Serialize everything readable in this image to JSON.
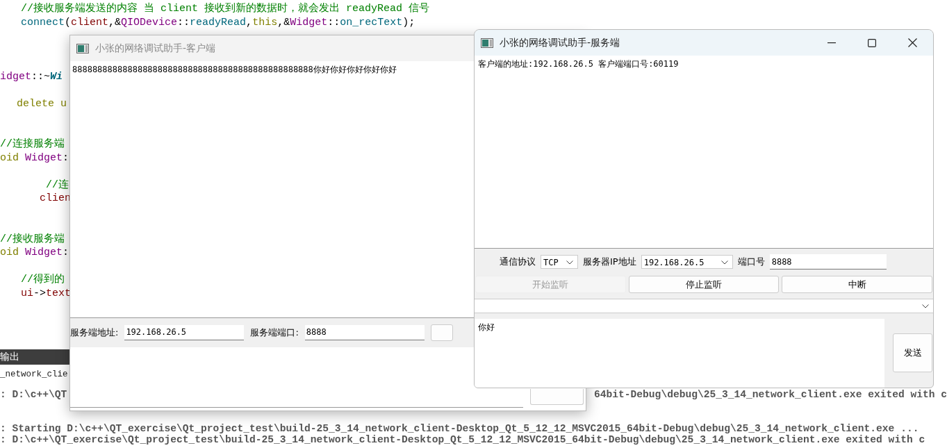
{
  "editor": {
    "lines": [
      {
        "segments": [
          {
            "kind": "comment",
            "text": "//接收服务端发送的内容 当 client 接收到新的数据时，就会发出 readyRead 信号"
          }
        ]
      },
      {
        "segments": [
          {
            "kind": "function",
            "text": "connect"
          },
          {
            "kind": "plain",
            "text": "("
          },
          {
            "kind": "member",
            "text": "client"
          },
          {
            "kind": "plain",
            "text": ",&"
          },
          {
            "kind": "type",
            "text": "QIODevice"
          },
          {
            "kind": "plain",
            "text": "::"
          },
          {
            "kind": "function",
            "text": "readyRead"
          },
          {
            "kind": "plain",
            "text": ","
          },
          {
            "kind": "keyword",
            "text": "this"
          },
          {
            "kind": "plain",
            "text": ",&"
          },
          {
            "kind": "type",
            "text": "Widget"
          },
          {
            "kind": "plain",
            "text": "::"
          },
          {
            "kind": "function",
            "text": "on_recText"
          },
          {
            "kind": "plain",
            "text": ");"
          }
        ]
      },
      {
        "segments": [
          {
            "kind": "type",
            "text": "idget"
          },
          {
            "kind": "plain",
            "text": "::~"
          },
          {
            "kind": "destructor",
            "text": "Wi"
          }
        ]
      },
      {
        "segments": [
          {
            "kind": "keyword",
            "text": "delete u"
          }
        ]
      },
      {
        "segments": [
          {
            "kind": "comment",
            "text": "//连接服务端"
          }
        ]
      },
      {
        "segments": [
          {
            "kind": "keyword",
            "text": "oid "
          },
          {
            "kind": "type",
            "text": "Widget"
          },
          {
            "kind": "plain",
            "text": ":"
          }
        ]
      },
      {
        "segments": [
          {
            "kind": "comment",
            "text": "//连"
          }
        ]
      },
      {
        "segments": [
          {
            "kind": "member",
            "text": "clien"
          }
        ]
      },
      {
        "segments": [
          {
            "kind": "comment",
            "text": "//接收服务端"
          }
        ]
      },
      {
        "segments": [
          {
            "kind": "keyword",
            "text": "oid "
          },
          {
            "kind": "type",
            "text": "Widget"
          },
          {
            "kind": "plain",
            "text": ":"
          }
        ]
      },
      {
        "segments": [
          {
            "kind": "comment",
            "text": "//得到的"
          }
        ]
      },
      {
        "segments": [
          {
            "kind": "member",
            "text": "ui"
          },
          {
            "kind": "plain",
            "text": "->"
          },
          {
            "kind": "member",
            "text": "text"
          }
        ]
      }
    ]
  },
  "output": {
    "title": "输出",
    "lines": [
      {
        "parts": [
          "_network_clie"
        ]
      },
      {
        "parts": [
          ": D:\\c++\\QT",
          "64bit-Debug\\debug\\25_3_14_network_client.exe exited with c"
        ]
      },
      {
        "parts": [
          ": Starting D:\\c++\\QT_exercise\\Qt_project_test\\build-25_3_14_network_client-Desktop_Qt_5_12_12_MSVC2015_64bit-Debug\\debug\\25_3_14_network_client.exe ..."
        ]
      },
      {
        "parts": [
          ": D:\\c++\\QT_exercise\\Qt_project_test\\build-25_3_14_network_client-Desktop_Qt_5_12_12_MSVC2015_64bit-Debug\\debug\\25_3_14_network_client.exe exited with c"
        ]
      }
    ]
  },
  "client_window": {
    "title": "小张的网络调试助手-客户端",
    "active": false,
    "received_text": "888888888888888888888888888888888888888888888888你好你好你好你好你好",
    "address_label": "服务端地址:",
    "address_value": "192.168.26.5",
    "port_label": "服务端端口:",
    "port_value": "8888"
  },
  "server_window": {
    "title": "小张的网络调试助手-服务端",
    "active": true,
    "log_text": "客户端的地址:192.168.26.5 客户端端口号:60119",
    "protocol_label": "通信协议",
    "protocol_value": "TCP",
    "ip_label": "服务器IP地址",
    "ip_value": "192.168.26.5",
    "port_label": "端口号",
    "port_value": "8888",
    "buttons": [
      {
        "label": "开始监听",
        "disabled": true
      },
      {
        "label": "停止监听",
        "disabled": false
      },
      {
        "label": "中断",
        "disabled": false
      }
    ],
    "message_text": "你好",
    "send_button": "发送"
  }
}
